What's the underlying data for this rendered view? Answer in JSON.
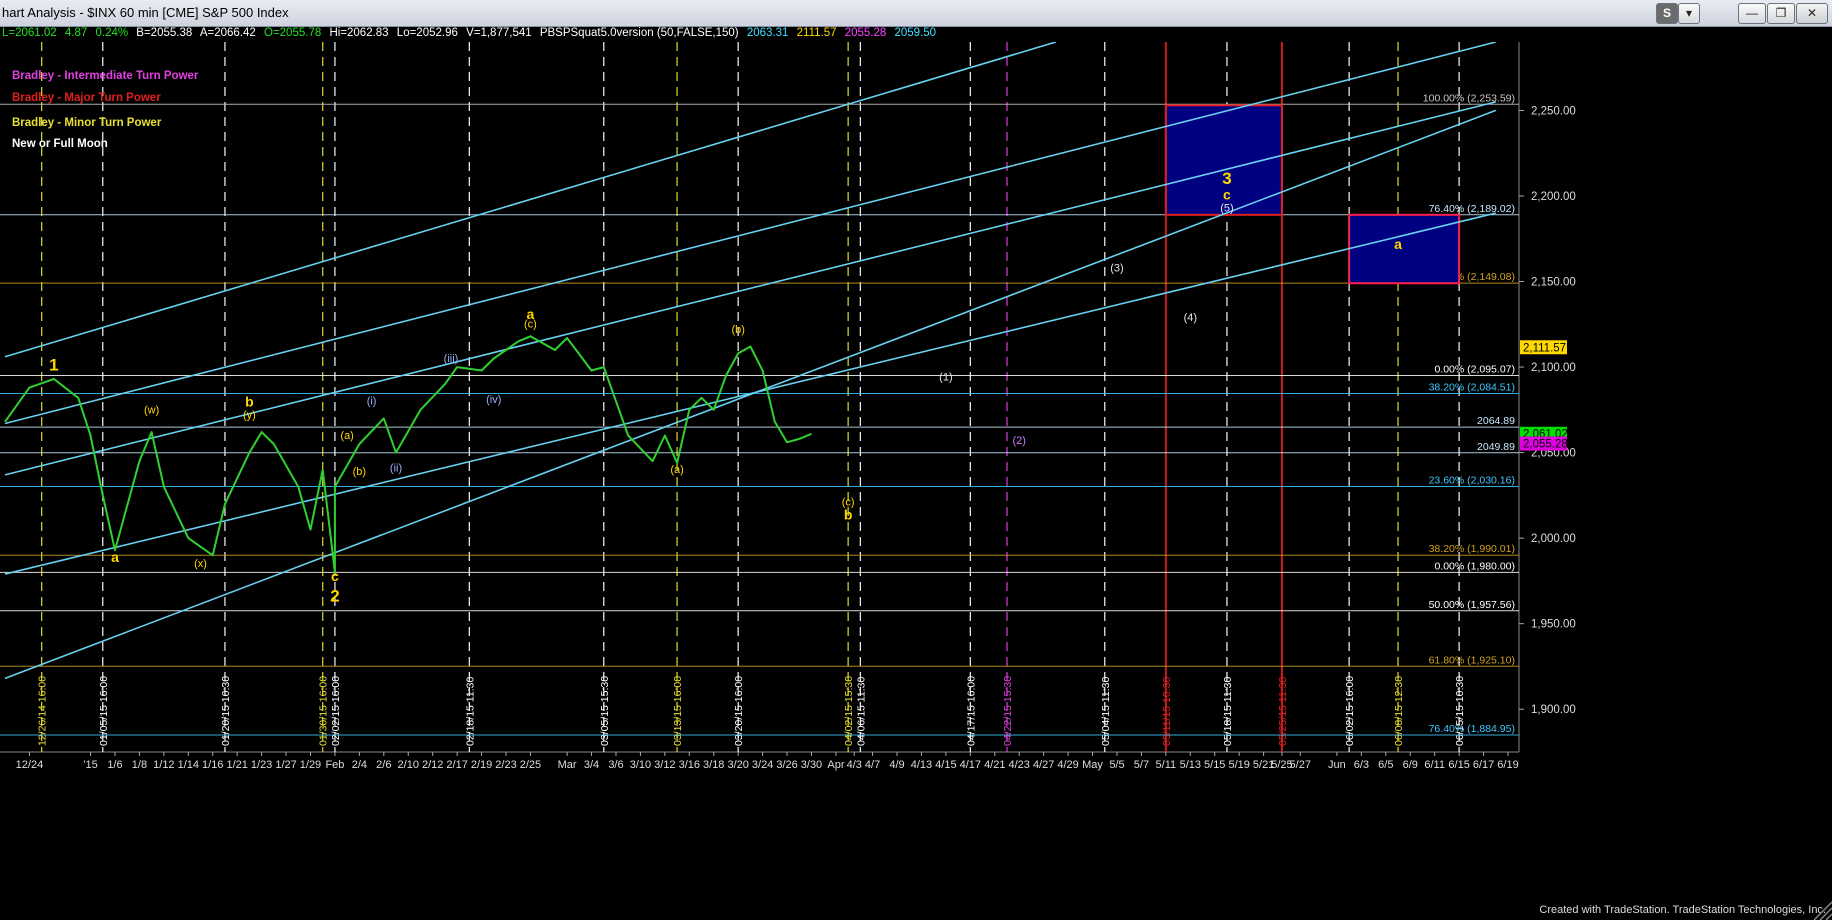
{
  "window": {
    "title": "hart Analysis - $INX 60 min [CME] S&P 500 Index",
    "btn_s": "S",
    "btn_dropdown": "▾",
    "btn_minimize": "—",
    "btn_restore": "❐",
    "btn_close": "✕"
  },
  "ohlc": {
    "last": "L=2061.02",
    "chg": "4.87",
    "pct": "0.24%",
    "b": "B=2055.38",
    "a": "A=2066.42",
    "o": "O=2055.78",
    "hi": "Hi=2062.83",
    "lo": "Lo=2052.96",
    "v": "V=1,877,541",
    "ind": "PBSPSquat5.0version (50,FALSE,150)",
    "v1": "2063.31",
    "v2": "2111.57",
    "v3": "2055.28",
    "v4": "2059.50"
  },
  "legend": [
    {
      "text": "Bradley - Intermediate Turn Power",
      "color": "#e040e0"
    },
    {
      "text": "Bradley - Major Turn Power",
      "color": "#e02020"
    },
    {
      "text": "Bradley - Minor Turn Power",
      "color": "#e8e030"
    },
    {
      "text": "New or Full Moon",
      "color": "#ffffff"
    }
  ],
  "credit": "Created with TradeStation. TradeStation Technologies, Inc.",
  "chart_data": {
    "type": "line",
    "title": "$INX 60 min [CME] S&P 500 Index",
    "ylim": [
      1875,
      2290
    ],
    "y_ticks": [
      1900,
      1950,
      2000,
      2050,
      2100,
      2150,
      2200,
      2250
    ],
    "y_tick_labels": [
      "1,900.00",
      "1,950.00",
      "2,000.00",
      "2,050.00",
      "2,100.00",
      "2,150.00",
      "2,200.00",
      "2,250.00"
    ],
    "x_ticks": [
      "12/24",
      "'15",
      "1/6",
      "1/8",
      "1/12",
      "1/14",
      "1/16",
      "1/21",
      "1/23",
      "1/27",
      "1/29",
      "Feb",
      "2/4",
      "2/6",
      "2/10",
      "2/12",
      "2/17",
      "2/19",
      "2/23",
      "2/25",
      "Mar",
      "3/4",
      "3/6",
      "3/10",
      "3/12",
      "3/16",
      "3/18",
      "3/20",
      "3/24",
      "3/26",
      "3/30",
      "Apr",
      "4/3",
      "4/7",
      "4/9",
      "4/13",
      "4/15",
      "4/17",
      "4/21",
      "4/23",
      "4/27",
      "4/29",
      "May",
      "5/5",
      "5/7",
      "5/11",
      "5/13",
      "5/15",
      "5/19",
      "5/21",
      "5/25",
      "5/27",
      "Jun",
      "6/3",
      "6/5",
      "6/9",
      "6/11",
      "6/15",
      "6/17",
      "6/19"
    ],
    "price_path": [
      {
        "x": "12/22",
        "y": 2068
      },
      {
        "x": "12/24",
        "y": 2088
      },
      {
        "x": "12/29",
        "y": 2093
      },
      {
        "x": "12/31",
        "y": 2082
      },
      {
        "x": "1/2",
        "y": 2060
      },
      {
        "x": "1/5",
        "y": 2025
      },
      {
        "x": "1/6",
        "y": 1993
      },
      {
        "x": "1/8",
        "y": 2045
      },
      {
        "x": "1/9",
        "y": 2062
      },
      {
        "x": "1/12",
        "y": 2030
      },
      {
        "x": "1/14",
        "y": 2000
      },
      {
        "x": "1/16",
        "y": 1990
      },
      {
        "x": "1/20",
        "y": 2020
      },
      {
        "x": "1/22",
        "y": 2050
      },
      {
        "x": "1/23",
        "y": 2062
      },
      {
        "x": "1/26",
        "y": 2055
      },
      {
        "x": "1/28",
        "y": 2030
      },
      {
        "x": "1/29",
        "y": 2005
      },
      {
        "x": "1/30",
        "y": 2040
      },
      {
        "x": "Feb",
        "y": 1980
      },
      {
        "x": "2/2",
        "y": 2030
      },
      {
        "x": "2/4",
        "y": 2055
      },
      {
        "x": "2/6",
        "y": 2070
      },
      {
        "x": "2/9",
        "y": 2050
      },
      {
        "x": "2/11",
        "y": 2075
      },
      {
        "x": "2/13",
        "y": 2090
      },
      {
        "x": "2/17",
        "y": 2100
      },
      {
        "x": "2/19",
        "y": 2098
      },
      {
        "x": "2/20",
        "y": 2105
      },
      {
        "x": "2/24",
        "y": 2115
      },
      {
        "x": "2/25",
        "y": 2118
      },
      {
        "x": "2/27",
        "y": 2110
      },
      {
        "x": "3/2",
        "y": 2117
      },
      {
        "x": "3/4",
        "y": 2098
      },
      {
        "x": "3/5",
        "y": 2100
      },
      {
        "x": "3/6",
        "y": 2080
      },
      {
        "x": "3/9",
        "y": 2060
      },
      {
        "x": "3/11",
        "y": 2045
      },
      {
        "x": "3/12",
        "y": 2060
      },
      {
        "x": "3/13",
        "y": 2044
      },
      {
        "x": "3/16",
        "y": 2075
      },
      {
        "x": "3/17",
        "y": 2082
      },
      {
        "x": "3/18",
        "y": 2075
      },
      {
        "x": "3/19",
        "y": 2095
      },
      {
        "x": "3/20",
        "y": 2108
      },
      {
        "x": "3/23",
        "y": 2112
      },
      {
        "x": "3/24",
        "y": 2098
      },
      {
        "x": "3/25",
        "y": 2068
      },
      {
        "x": "3/26",
        "y": 2056
      },
      {
        "x": "3/27",
        "y": 2058
      },
      {
        "x": "3/30",
        "y": 2061
      }
    ],
    "horizontal_levels": [
      {
        "label": "100.00% (2,253.59)",
        "y": 2253.59,
        "color": "#c8c8c8"
      },
      {
        "label": "76.40% (2,189.02)",
        "y": 2189.02,
        "color": "#c8e8ff"
      },
      {
        "label": "61.80% (2,149.08)",
        "y": 2149.08,
        "color": "#d0a020"
      },
      {
        "label": "0.00% (2,095.07)",
        "y": 2095.07,
        "color": "#ffffff"
      },
      {
        "label": "38.20% (2,084.51)",
        "y": 2084.51,
        "color": "#40c8ff"
      },
      {
        "label": "2064.89",
        "y": 2064.89,
        "color": "#c8e8ff"
      },
      {
        "label": "2049.89",
        "y": 2049.89,
        "color": "#c8e8ff"
      },
      {
        "label": "23.60% (2,030.16)",
        "y": 2030.16,
        "color": "#40c8ff"
      },
      {
        "label": "38.20% (1,990.01)",
        "y": 1990.01,
        "color": "#d0a020"
      },
      {
        "label": "0.00% (1,980.00)",
        "y": 1980,
        "color": "#ffffff"
      },
      {
        "label": "50.00% (1,957.56)",
        "y": 1957.56,
        "color": "#ffffff"
      },
      {
        "label": "61.80% (1,925.10)",
        "y": 1925.1,
        "color": "#d0a020"
      },
      {
        "label": "76.40% (1,884.95)",
        "y": 1884.95,
        "color": "#40c8ff"
      }
    ],
    "price_tags": [
      {
        "text": "2,111.57",
        "y": 2111.57,
        "bg": "#ffd800",
        "fg": "#000"
      },
      {
        "text": "2,061.02",
        "y": 2061.02,
        "bg": "#00e000",
        "fg": "#000"
      },
      {
        "text": "2,055.28",
        "y": 2055.28,
        "bg": "#e000e0",
        "fg": "#000"
      }
    ],
    "channel_lines": [
      {
        "from": {
          "x": "12/22",
          "y": 2106
        },
        "to": {
          "x": "4/28",
          "y": 2290
        }
      },
      {
        "from": {
          "x": "12/22",
          "y": 2067
        },
        "to": {
          "x": "6/18",
          "y": 2290
        }
      },
      {
        "from": {
          "x": "12/22",
          "y": 2037
        },
        "to": {
          "x": "6/18",
          "y": 2255
        }
      },
      {
        "from": {
          "x": "12/22",
          "y": 1979
        },
        "to": {
          "x": "6/18",
          "y": 2190
        }
      },
      {
        "from": {
          "x": "12/22",
          "y": 1918
        },
        "to": {
          "x": "6/18",
          "y": 2250
        }
      }
    ],
    "boxes": [
      {
        "from": {
          "x": "5/11",
          "y": 2253
        },
        "to": {
          "x": "5/25",
          "y": 2189
        }
      },
      {
        "from": {
          "x": "6/2",
          "y": 2189
        },
        "to": {
          "x": "6/15",
          "y": 2149
        }
      }
    ],
    "vertical_markers": [
      {
        "label": "12/26/14 16:00",
        "x": "12/26",
        "color": "#e8e030"
      },
      {
        "label": "01/05/15 16:00",
        "x": "1/5",
        "color": "#fff"
      },
      {
        "label": "01/20/15 10:30",
        "x": "1/20",
        "color": "#fff"
      },
      {
        "label": "01/30/15 16:00",
        "x": "1/30",
        "color": "#e8e030"
      },
      {
        "label": "02/02/15 16:00",
        "x": "2/2",
        "color": "#fff"
      },
      {
        "label": "02/18/15 11:30",
        "x": "2/18",
        "color": "#fff"
      },
      {
        "label": "03/05/15 15:30",
        "x": "3/5",
        "color": "#fff"
      },
      {
        "label": "03/13/15 16:00",
        "x": "3/13",
        "color": "#e8e030"
      },
      {
        "label": "03/20/15 16:00",
        "x": "3/20",
        "color": "#fff"
      },
      {
        "label": "04/02/15 15:30",
        "x": "4/2",
        "color": "#e8e030"
      },
      {
        "label": "04/06/15 11:30",
        "x": "4/6",
        "color": "#fff"
      },
      {
        "label": "04/17/15 16:00",
        "x": "4/17",
        "color": "#fff"
      },
      {
        "label": "04/22/15 15:30",
        "x": "4/22",
        "color": "#e040e0"
      },
      {
        "label": "05/04/15 11:30",
        "x": "5/4",
        "color": "#fff"
      },
      {
        "label": "05/11/15 10:30",
        "x": "5/11",
        "color": "#e02020"
      },
      {
        "label": "05/18/15 11:30",
        "x": "5/18",
        "color": "#fff"
      },
      {
        "label": "05/25/15 11:30",
        "x": "5/25",
        "color": "#e02020"
      },
      {
        "label": "06/02/15 16:00",
        "x": "6/2",
        "color": "#fff"
      },
      {
        "label": "06/08/15 12:30",
        "x": "6/8",
        "color": "#e8e030"
      },
      {
        "label": "06/15/15 10:30",
        "x": "6/15",
        "color": "#fff"
      }
    ],
    "annotations": [
      {
        "text": "1",
        "x": "12/29",
        "y": 2098,
        "color": "#ffd800"
      },
      {
        "text": "a",
        "x": "1/6",
        "y": 1986,
        "color": "#ffd800"
      },
      {
        "text": "(w)",
        "x": "1/9",
        "y": 2073,
        "color": "#ffd800"
      },
      {
        "text": "(x)",
        "x": "1/15",
        "y": 1983,
        "color": "#ffd800"
      },
      {
        "text": "b",
        "x": "1/22",
        "y": 2077,
        "color": "#ffd800"
      },
      {
        "text": "(y)",
        "x": "1/22",
        "y": 2070,
        "color": "#ffd800"
      },
      {
        "text": "c",
        "x": "Feb",
        "y": 1975,
        "color": "#ffd800"
      },
      {
        "text": "2",
        "x": "Feb",
        "y": 1963,
        "color": "#ffd800"
      },
      {
        "text": "(a)",
        "x": "2/3",
        "y": 2058,
        "color": "#ffd800"
      },
      {
        "text": "(b)",
        "x": "2/4",
        "y": 2037,
        "color": "#ffd800"
      },
      {
        "text": "(i)",
        "x": "2/5",
        "y": 2078,
        "color": "#9ab0ff"
      },
      {
        "text": "(ii)",
        "x": "2/9",
        "y": 2039,
        "color": "#9ab0ff"
      },
      {
        "text": "(iii)",
        "x": "2/16",
        "y": 2103,
        "color": "#9ab0ff"
      },
      {
        "text": "(iv)",
        "x": "2/20",
        "y": 2079,
        "color": "#9ab0ff"
      },
      {
        "text": "a",
        "x": "2/25",
        "y": 2128,
        "color": "#ffd800"
      },
      {
        "text": "(c)",
        "x": "2/25",
        "y": 2123,
        "color": "#ffd800"
      },
      {
        "text": "(a)",
        "x": "3/13",
        "y": 2038,
        "color": "#ffd800"
      },
      {
        "text": "(b)",
        "x": "3/20",
        "y": 2120,
        "color": "#ffd800"
      },
      {
        "text": "(c)",
        "x": "4/2",
        "y": 2019,
        "color": "#ffd800"
      },
      {
        "text": "b",
        "x": "4/2",
        "y": 2011,
        "color": "#ffd800"
      },
      {
        "text": "(1)",
        "x": "4/15",
        "y": 2092,
        "color": "#e6e6e6"
      },
      {
        "text": "(2)",
        "x": "4/23",
        "y": 2055,
        "color": "#c878ff"
      },
      {
        "text": "(3)",
        "x": "5/5",
        "y": 2156,
        "color": "#e6e6e6"
      },
      {
        "text": "(4)",
        "x": "5/13",
        "y": 2127,
        "color": "#e6e6e6"
      },
      {
        "text": "3",
        "x": "5/18",
        "y": 2207,
        "color": "#ffd800"
      },
      {
        "text": "c",
        "x": "5/18",
        "y": 2198,
        "color": "#ffd800"
      },
      {
        "text": "(5)",
        "x": "5/18",
        "y": 2191,
        "color": "#e6e6e6"
      },
      {
        "text": "a",
        "x": "6/8",
        "y": 2169,
        "color": "#ffd800"
      }
    ]
  }
}
